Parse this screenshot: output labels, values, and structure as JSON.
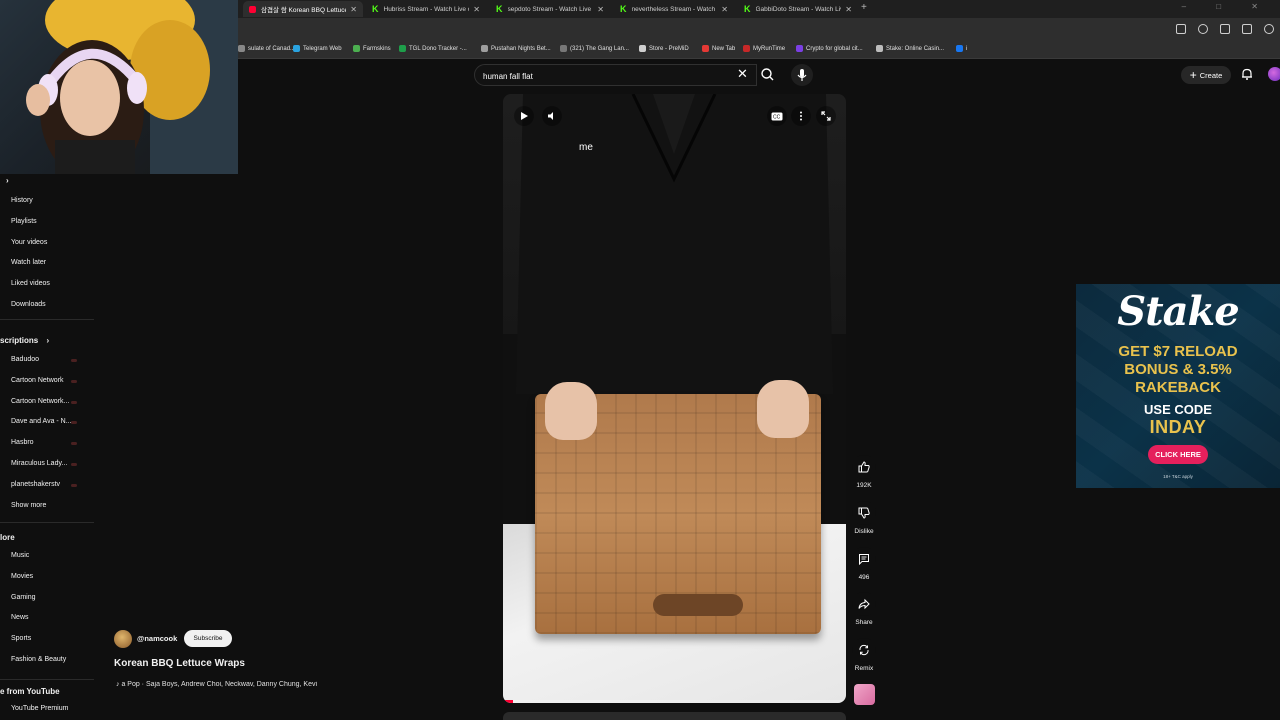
{
  "browser": {
    "tabs": [
      {
        "title": "삼겹살 쌈 Korean BBQ Lettuce",
        "kind": "yt",
        "active": true
      },
      {
        "title": "Hubriss Stream - Watch Live o",
        "kind": "kick",
        "active": false
      },
      {
        "title": "sepdoto Stream - Watch Live o",
        "kind": "kick",
        "active": false
      },
      {
        "title": "nevertheless Stream - Watch Li",
        "kind": "kick",
        "active": false
      },
      {
        "title": "GabbiDoto Stream - Watch Live",
        "kind": "kick",
        "active": false
      }
    ],
    "new_tab": "+",
    "bookmarks": [
      {
        "label": "sulate of Canad...",
        "color": "#888888"
      },
      {
        "label": "Telegram Web",
        "color": "#2aa3e0"
      },
      {
        "label": "Farmskins",
        "color": "#4caf50"
      },
      {
        "label": "TGL Dono Tracker -...",
        "color": "#1e9e4a"
      },
      {
        "label": "Pustahan Nights Bet...",
        "color": "#9e9e9e"
      },
      {
        "label": "(321) The Gang Lan...",
        "color": "#777777"
      },
      {
        "label": "Store - PreMiD",
        "color": "#cfcfcf"
      },
      {
        "label": "New Tab",
        "color": "#e53935"
      },
      {
        "label": "MyRunTime",
        "color": "#c62828"
      },
      {
        "label": "Crypto for global cit...",
        "color": "#7b3fe4"
      },
      {
        "label": "Stake: Online Casin...",
        "color": "#bdbdbd"
      },
      {
        "label": "i",
        "color": "#1877f2"
      }
    ]
  },
  "header": {
    "search_value": "human fall flat",
    "create_label": "Create"
  },
  "sidebar": {
    "you_items": [
      "History",
      "Playlists",
      "Your videos",
      "Watch later",
      "Liked videos",
      "Downloads"
    ],
    "subscriptions_heading": "scriptions",
    "subscriptions": [
      "Badudoo",
      "Cartoon Network",
      "Cartoon Network...",
      "Dave and Ava - N...",
      "Hasbro",
      "Miraculous Lady...",
      "planetshakerstv"
    ],
    "show_more": "Show more",
    "explore_heading": "lore",
    "explore_items": [
      "Music",
      "Movies",
      "Gaming",
      "News",
      "Sports",
      "Fashion & Beauty"
    ],
    "more_heading": "e from YouTube",
    "more_items": [
      "YouTube Premium"
    ]
  },
  "video": {
    "caption": "me",
    "progress": 0.03
  },
  "actions": {
    "like_count": "192K",
    "dislike_label": "Dislike",
    "comment_count": "496",
    "share_label": "Share",
    "remix_label": "Remix"
  },
  "channel": {
    "handle": "@namcook",
    "subscribe_label": "Subscribe",
    "title": "Korean BBQ Lettuce Wraps",
    "music": "♪ a Pop · Saja Boys, Andrew Choi, Neckwav, Danny Chung, Kevi"
  },
  "ad": {
    "logo": "Stake",
    "headline_lines": [
      "GET $7 RELOAD",
      "BONUS & 3.5%",
      "RAKEBACK"
    ],
    "use_code": "USE CODE",
    "code": "INDAY",
    "cta": "CLICK HERE",
    "fine_print": "18+ T&C apply",
    "colors": {
      "gold": "#e9c24d",
      "cta": "#e5205c",
      "bg": "#0b3248"
    }
  },
  "colors": {
    "accent": "#ff0033",
    "bg": "#0f0f0f"
  }
}
